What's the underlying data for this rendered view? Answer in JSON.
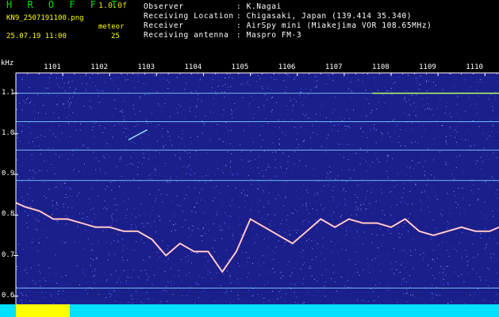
{
  "header": {
    "title": "H R O F F T",
    "version": "1.0.0f",
    "filename": "KN9_2507191100.png",
    "station_label": "meteor",
    "datetime": "25.07.19 11:00",
    "count": "25"
  },
  "info": [
    {
      "label": "Observer",
      "value": ": K.Nagai"
    },
    {
      "label": "Receiving Location",
      "value": ": Chigasaki, Japan (139.414 35.340)"
    },
    {
      "label": "Receiver",
      "value": ": AirSpy mini (Miakejima VOR 108.65MHz)"
    },
    {
      "label": "Receiving antenna",
      "value": ": Maspro FM-3"
    }
  ],
  "chart_data": {
    "type": "heatmap",
    "ylabel": "kHz",
    "y_ticks": [
      "1.1",
      "1.0",
      "0.9",
      "0.8",
      "0.7",
      "0.6"
    ],
    "x_ticks": [
      "1101",
      "1102",
      "1103",
      "1104",
      "1105",
      "1106",
      "1107",
      "1108",
      "1109",
      "1110"
    ],
    "ylim": [
      0.58,
      1.15
    ],
    "xlim": [
      1100,
      1110.3
    ],
    "background_color": "#1a1f8c",
    "horizontal_carriers_khz": [
      1.1,
      1.03,
      0.96,
      0.885,
      0.62
    ],
    "drift_trace": {
      "x": [
        1100.0,
        1100.2,
        1100.5,
        1100.8,
        1101.1,
        1101.4,
        1101.7,
        1102.0,
        1102.3,
        1102.6,
        1102.9,
        1103.2,
        1103.5,
        1103.8,
        1104.1,
        1104.4,
        1104.7,
        1105.0,
        1105.3,
        1105.6,
        1105.9,
        1106.2,
        1106.5,
        1106.8,
        1107.1,
        1107.4,
        1107.7,
        1108.0,
        1108.3,
        1108.6,
        1108.9,
        1109.2,
        1109.5,
        1109.8,
        1110.1,
        1110.3
      ],
      "y": [
        0.83,
        0.82,
        0.81,
        0.79,
        0.79,
        0.78,
        0.77,
        0.77,
        0.76,
        0.76,
        0.74,
        0.7,
        0.73,
        0.71,
        0.71,
        0.66,
        0.71,
        0.79,
        0.77,
        0.75,
        0.73,
        0.76,
        0.79,
        0.77,
        0.79,
        0.78,
        0.78,
        0.77,
        0.79,
        0.76,
        0.75,
        0.76,
        0.77,
        0.76,
        0.76,
        0.77
      ]
    },
    "meteor_streak": {
      "x": [
        1102.4,
        1102.8
      ],
      "y": [
        0.985,
        1.01
      ]
    },
    "strong_segment": {
      "x": [
        1107.6,
        1110.3
      ],
      "y": 1.1
    },
    "bottom_bar_colors": [
      "#ffff00",
      "#00e0ff"
    ]
  }
}
